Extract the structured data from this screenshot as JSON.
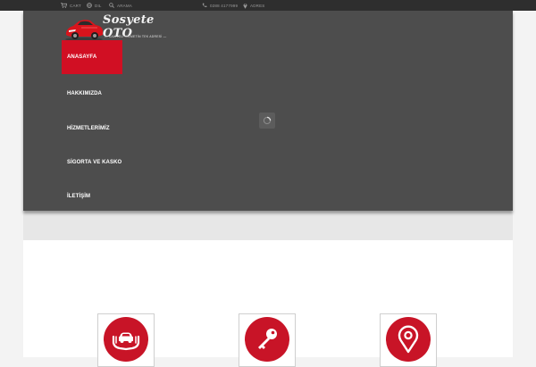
{
  "topbar": {
    "cart_label": "CART",
    "language_label": "DIL",
    "search_label": "ARAMA",
    "phone_label": "0288 4177999",
    "address_label": "ADRES"
  },
  "logo": {
    "title": "Sosyete OTO",
    "slogan": "— KALİTELİ HİZMETİN TEK ADRESİ —"
  },
  "nav": {
    "items": [
      {
        "label": "ANASAYFA",
        "active": true
      },
      {
        "label": "HAKKIMIZDA"
      },
      {
        "label": "HİZMETLERİMİZ"
      },
      {
        "label": "SİGORTA VE KASKO"
      },
      {
        "label": "İLETİŞİM"
      }
    ]
  },
  "features": [
    {
      "icon": "car-in-hands-icon"
    },
    {
      "icon": "key-icon"
    },
    {
      "icon": "location-pin-icon"
    }
  ],
  "colors": {
    "accent": "#d10f23",
    "header": "#4d4d4d",
    "topbar": "#2e2e2e"
  }
}
